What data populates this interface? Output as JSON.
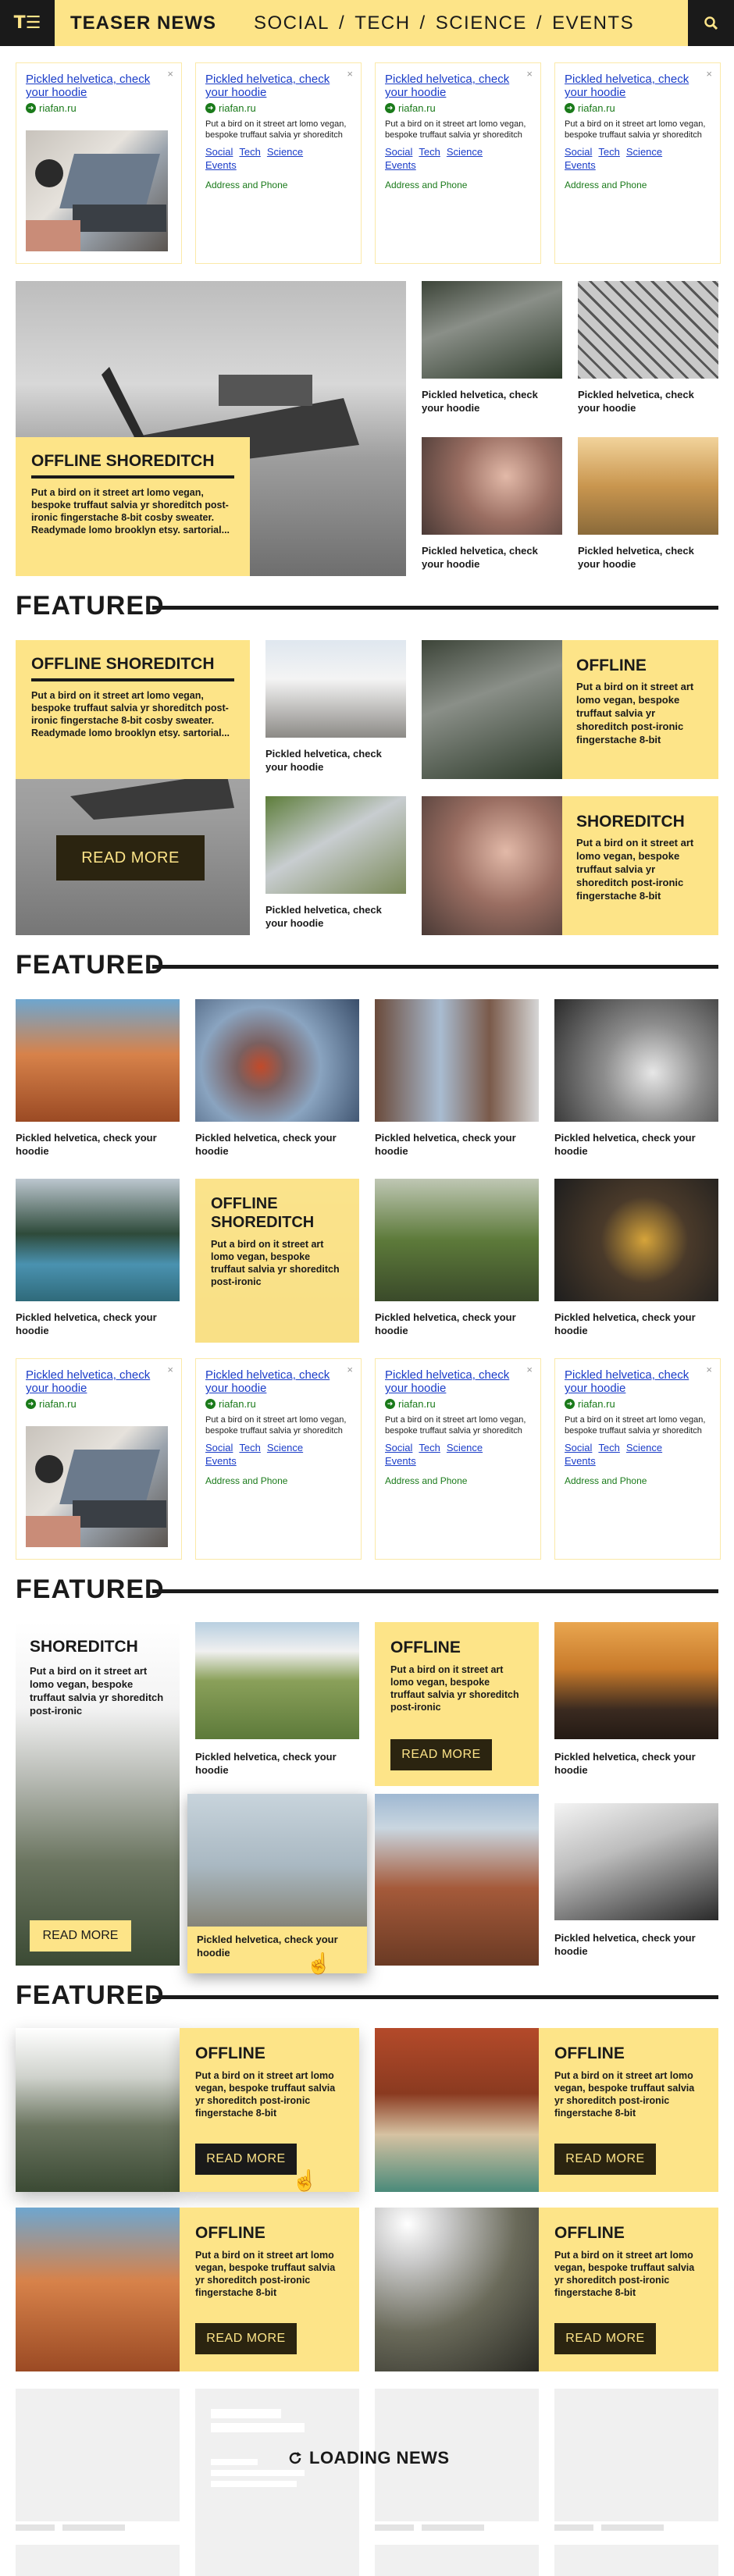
{
  "header": {
    "logo": "T☰",
    "brand": "TEASER NEWS",
    "nav": [
      "SOCIAL",
      "TECH",
      "SCIENCE",
      "EVENTS"
    ],
    "nav_sep": "/",
    "search_icon": "search-icon"
  },
  "ad": {
    "title": "Pickled helvetica, check your hoodie",
    "close": "×",
    "source": "riafan.ru",
    "body": "Put a bird on it street art lomo vegan, bespoke truffaut salvia yr shoreditch",
    "links": [
      "Social",
      "Tech",
      "Science",
      "Events"
    ],
    "address": "Address and Phone"
  },
  "hero": {
    "title": "OFFLINE SHOREDITCH",
    "text": "Put a bird on it street art lomo vegan, bespoke truffaut salvia yr shoreditch post-ironic fingerstache 8-bit cosby sweater.  Readymade lomo brooklyn etsy. sartorial..."
  },
  "caption": "Pickled helvetica, check your hoodie",
  "featured_label": "FEATURED",
  "f1": {
    "title": "OFFLINE SHOREDITCH",
    "text": "Put a bird on it street art lomo vegan, bespoke truffaut salvia yr shoreditch post-ironic fingerstache 8-bit cosby sweater.  Readymade lomo brooklyn etsy. sartorial...",
    "read_more": "READ MORE",
    "tile_offline": "OFFLINE",
    "tile_shoreditch": "SHOREDITCH",
    "tile_text": "Put a bird on it street art lomo vegan, bespoke truffaut salvia yr shoreditch post-ironic fingerstache 8-bit"
  },
  "f2": {
    "title": "OFFLINE SHOREDITCH",
    "text": "Put a bird on it street art lomo vegan, bespoke truffaut salvia yr shoreditch post-ironic"
  },
  "f3": {
    "shoreditch": "SHOREDITCH",
    "offline": "OFFLINE",
    "text": "Put a bird on it street art lomo vegan, bespoke truffaut salvia yr shoreditch post-ironic",
    "read_more": "READ MORE"
  },
  "f4": {
    "title": "OFFLINE",
    "text": "Put a bird on it street art lomo vegan, bespoke truffaut salvia yr shoreditch post-ironic fingerstache 8-bit",
    "read_more": "READ MORE"
  },
  "loading": {
    "icon": "refresh-icon",
    "label": "LOADING NEWS"
  },
  "colors": {
    "accent": "#fde488",
    "dark": "#1a1a1a",
    "link": "#1a3cc8",
    "green": "#1a7a1a"
  }
}
